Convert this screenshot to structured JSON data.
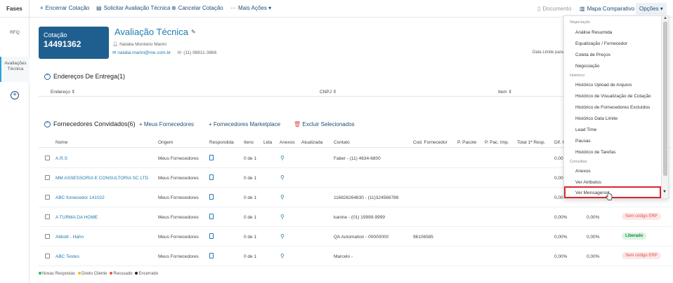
{
  "topbar": {
    "fases": "Fases",
    "actions": [
      {
        "icon": "close-icon",
        "glyph": "×",
        "label": "Encerrar Cotação"
      },
      {
        "icon": "document-icon",
        "glyph": "▤",
        "label": "Solicitar Avaliação Técnica"
      },
      {
        "icon": "cancel-circle-icon",
        "glyph": "⊗",
        "label": "Cancelar Cotação"
      },
      {
        "icon": "more-dots-icon",
        "glyph": "···",
        "label": "Mais Ações ▾"
      }
    ],
    "documento": "Documento",
    "mapa": "Mapa Comparativo",
    "opcoes": "Opções ▾"
  },
  "rail": {
    "rfq": "RFQ",
    "avaliacoes": "Avaliações Técnica",
    "add": "+"
  },
  "header": {
    "cotacao_label": "Cotação",
    "cotacao_num": "14491362",
    "title": "Avaliação Técnica",
    "user": "Natalia Monteiro Marini",
    "email": "natalia.marini@me.com.br",
    "phone": "(11) 98811-3866",
    "data_limite": "Data Limite para"
  },
  "enderecos": {
    "title": "Endereços De Entrega(1)",
    "cols": [
      "Endereço ⇕",
      "CNPJ ⇕",
      "Item ⇕"
    ]
  },
  "fornecedores": {
    "title": "Fornecedores Convidados(6)",
    "meus": "+ Meus Fornecedores",
    "marketplace": "+ Fornecedores Marketplace",
    "excluir": "Excluir Selecionados",
    "columns": [
      "Nome",
      "Origem",
      "Respondida",
      "Itens",
      "Lida",
      "Anexos",
      "Atualizada",
      "Contato",
      "Cod. Fornecedor",
      "P. Pacote",
      "P. Pac. Imp.",
      "Total 1ª Resp.",
      "Dif. P"
    ],
    "rows": [
      {
        "nome": "A.R.S",
        "origem": "Meus Fornecedores",
        "itens": "0 de 1",
        "contato": "Faber - (11) 4634-6800",
        "cod": "",
        "dif1": "0,00%",
        "dif2": "",
        "status": "",
        "status_type": ""
      },
      {
        "nome": "MM ASSESSORIA E CONSULTORIA SC LTD",
        "origem": "Meus Fornecedores",
        "itens": "0 de 1",
        "contato": "",
        "cod": "",
        "dif1": "0,00%",
        "dif2": "",
        "status": "",
        "status_type": ""
      },
      {
        "nome": "ABC fornecedor 141022",
        "origem": "Meus Fornecedores",
        "itens": "0 de 1",
        "contato": "116826264830 - (11)324566788",
        "cod": "",
        "dif1": "0,00%",
        "dif2": "",
        "status": "",
        "status_type": ""
      },
      {
        "nome": "A TURMA DA HOME",
        "origem": "Meus Fornecedores",
        "itens": "0 de 1",
        "contato": "kanine - (01) 19999-9999",
        "cod": "",
        "dif1": "0,00%",
        "dif2": "0,00%",
        "status": "Sem código ERP",
        "status_type": "red"
      },
      {
        "nome": "Abbott - Hahn",
        "origem": "Meus Fornecedores",
        "itens": "0 de 1",
        "contato": "QA Automation - 00000000",
        "cod": "96106585",
        "dif1": "0,00%",
        "dif2": "0,00%",
        "status": "Liberado",
        "status_type": "green"
      },
      {
        "nome": "ABC Testes",
        "origem": "Meus Fornecedores",
        "itens": "0 de 1",
        "contato": "Marcelo -",
        "cod": "",
        "dif1": "0,00%",
        "dif2": "0,00%",
        "status": "Sem código ERP",
        "status_type": "red"
      }
    ]
  },
  "legend": [
    {
      "label": "Novas Respostas",
      "color": "#2bb673"
    },
    {
      "label": "Direto Cliente",
      "color": "#f5b82e"
    },
    {
      "label": "Recusado",
      "color": "#e4572e"
    },
    {
      "label": "Encerrado",
      "color": "#222222"
    }
  ],
  "dropdown": {
    "groups": [
      {
        "title": "Negociação",
        "items": [
          "Análise Resumida",
          "Equalização / Fornecedor",
          "Coleta de Preços",
          "Negociação"
        ]
      },
      {
        "title": "Histórico",
        "items": [
          "Histórico Upload de Arquivo",
          "Histórico de Visualização de Cotação",
          "Histórico de Fornecedores Excluídos",
          "Histórico Data Limite",
          "Lead Time",
          "Pausas",
          "Histórico de Tarefas"
        ]
      },
      {
        "title": "Consultas",
        "items": [
          "Anexos",
          "Ver Atributos",
          "Ver Mensagens"
        ]
      }
    ],
    "highlighted": "Ver Mensagens"
  }
}
